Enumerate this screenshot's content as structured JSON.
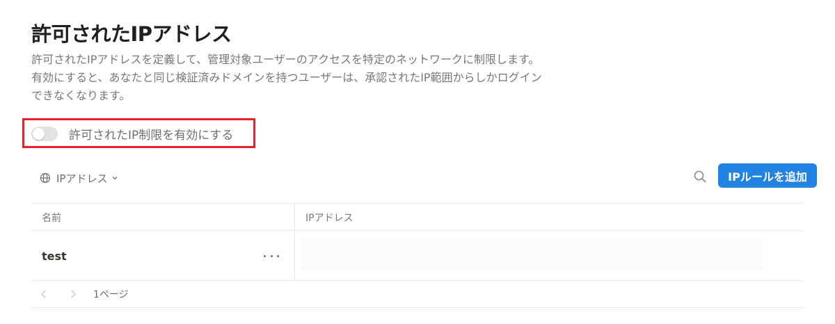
{
  "header": {
    "title": "許可されたIPアドレス",
    "description_lines": [
      "許可されたIPアドレスを定義して、管理対象ユーザーのアクセスを特定のネットワークに制限します。",
      "有効にすると、あなたと同じ検証済みドメインを持つユーザーは、承認されたIP範囲からしかログイン",
      "できなくなります。"
    ]
  },
  "toggle": {
    "label": "許可されたIP制限を有効にする",
    "enabled": false
  },
  "toolbar": {
    "filter_label": "IPアドレス",
    "filter_icon": "globe-icon",
    "search_icon": "search-icon",
    "add_button_label": "IPルールを追加"
  },
  "table": {
    "columns": [
      "名前",
      "IPアドレス"
    ],
    "rows": [
      {
        "name": "test",
        "ip_address": ""
      }
    ]
  },
  "pagination": {
    "page_label": "1ページ"
  },
  "colors": {
    "accent": "#2383e2",
    "highlight": "#e8202e",
    "toggle_off": "#e3e2e0"
  }
}
